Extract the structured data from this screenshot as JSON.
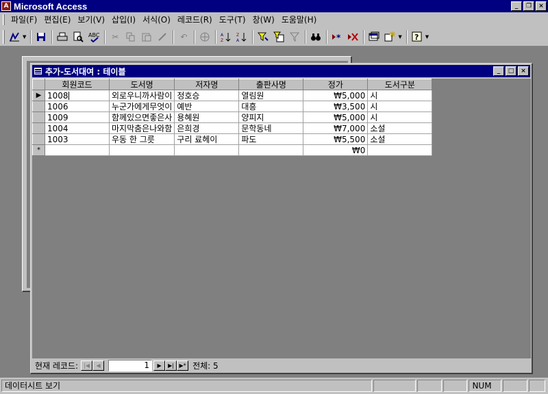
{
  "app": {
    "title": "Microsoft Access",
    "caption_buttons": [
      "_",
      "❐",
      "×"
    ]
  },
  "menu": [
    "파일(F)",
    "편집(E)",
    "보기(V)",
    "삽입(I)",
    "서식(O)",
    "레코드(R)",
    "도구(T)",
    "창(W)",
    "도움말(H)"
  ],
  "toolbar": {
    "icons": [
      "view-icon",
      "save-icon",
      "print-icon",
      "print-preview-icon",
      "spelling-icon",
      "cut-icon",
      "copy-icon",
      "paste-icon",
      "format-painter-icon",
      "undo-icon",
      "hyperlink-icon",
      "sort-ascending-icon",
      "sort-descending-icon",
      "filter-by-selection-icon",
      "filter-by-form-icon",
      "apply-filter-icon",
      "find-icon",
      "new-record-icon",
      "delete-record-icon",
      "database-window-icon",
      "new-object-icon",
      "help-icon"
    ]
  },
  "table_window": {
    "title": "추가-도서대여 : 테이블",
    "columns": [
      "회원코드",
      "도서명",
      "저자명",
      "출판사명",
      "정가",
      "도서구분"
    ],
    "rows": [
      [
        "1008",
        "외로우니까사람이",
        "정호승",
        "열림원",
        "₩5,000",
        "시"
      ],
      [
        "1006",
        "누군가에게무엇이",
        "예반",
        "대흥",
        "₩3,500",
        "시"
      ],
      [
        "1009",
        "함께있으면좋은사",
        "용혜원",
        "양피지",
        "₩5,000",
        "시"
      ],
      [
        "1004",
        "마지막춤은나와함",
        "은희경",
        "문학동네",
        "₩7,000",
        "소설"
      ],
      [
        "1003",
        "우동 한 그릇",
        "구리 료헤이",
        "파도",
        "₩5,500",
        "소설"
      ]
    ],
    "new_row_marker": "*",
    "new_row_default_price": "₩0",
    "current_row_marker": "▶"
  },
  "navigation": {
    "current_label": "현재 레코드:",
    "current_record": "1",
    "total_label": "전체: 5"
  },
  "statusbar": {
    "mode": "데이터시트 보기",
    "num": "NUM"
  }
}
